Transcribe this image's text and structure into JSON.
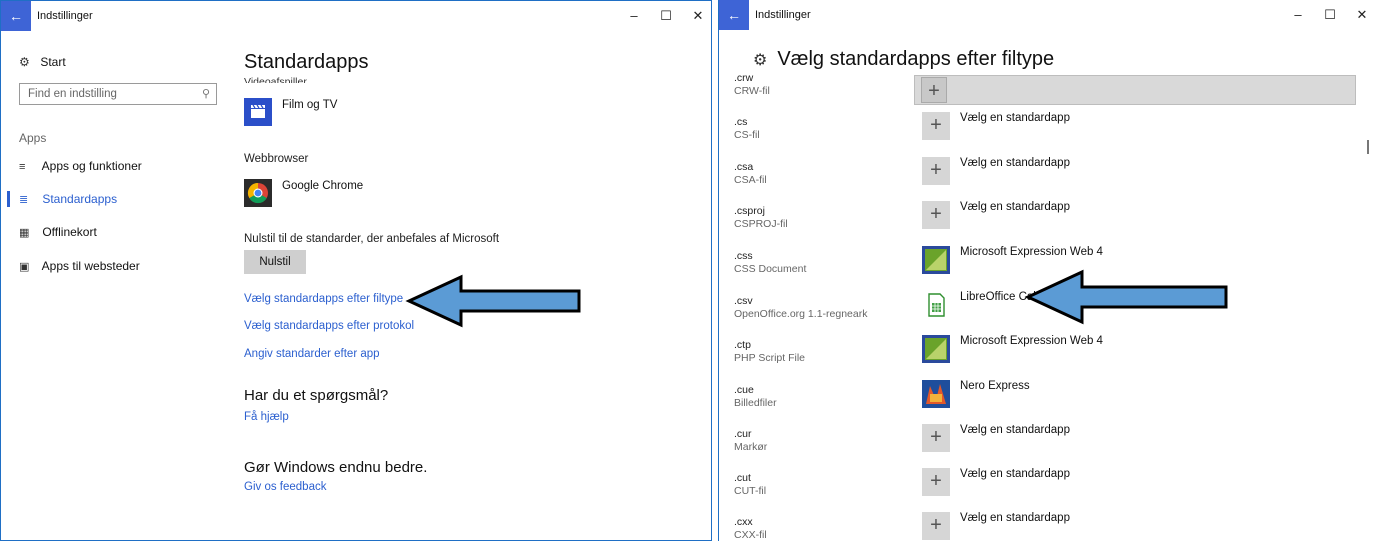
{
  "left": {
    "window_title": "Indstillinger",
    "nav": {
      "start": "Start",
      "search_placeholder": "Find en indstilling",
      "group": "Apps",
      "items": [
        {
          "label": "Apps og funktioner",
          "icon": "list-icon"
        },
        {
          "label": "Standardapps",
          "icon": "defaults-icon"
        },
        {
          "label": "Offlinekort",
          "icon": "map-icon"
        },
        {
          "label": "Apps til websteder",
          "icon": "web-app-icon"
        }
      ]
    },
    "main": {
      "title": "Standardapps",
      "video_label": "Videoafspiller",
      "video_app": "Film og TV",
      "browser_label": "Webbrowser",
      "browser_app": "Google Chrome",
      "reset_label": "Nulstil til de standarder, der anbefales af Microsoft",
      "reset_button": "Nulstil",
      "links": [
        "Vælg standardapps efter filtype",
        "Vælg standardapps efter protokol",
        "Angiv standarder efter app"
      ],
      "question_heading": "Har du et spørgsmål?",
      "help_link": "Få hjælp",
      "feedback_heading": "Gør Windows endnu bedre.",
      "feedback_link": "Giv os feedback"
    }
  },
  "right": {
    "window_title": "Indstillinger",
    "title": "Vælg standardapps efter filtype",
    "rows": [
      {
        "ext": ".crw",
        "desc": "CRW-fil",
        "app": ""
      },
      {
        "ext": ".cs",
        "desc": "CS-fil",
        "app": "Vælg en standardapp"
      },
      {
        "ext": ".csa",
        "desc": "CSA-fil",
        "app": "Vælg en standardapp"
      },
      {
        "ext": ".csproj",
        "desc": "CSPROJ-fil",
        "app": "Vælg en standardapp"
      },
      {
        "ext": ".css",
        "desc": "CSS Document",
        "app": "Microsoft Expression Web 4"
      },
      {
        "ext": ".csv",
        "desc": "OpenOffice.org 1.1-regneark",
        "app": "LibreOffice Calc"
      },
      {
        "ext": ".ctp",
        "desc": "PHP Script File",
        "app": "Microsoft Expression Web 4"
      },
      {
        "ext": ".cue",
        "desc": "Billedfiler",
        "app": "Nero Express"
      },
      {
        "ext": ".cur",
        "desc": "Markør",
        "app": "Vælg en standardapp"
      },
      {
        "ext": ".cut",
        "desc": "CUT-fil",
        "app": "Vælg en standardapp"
      },
      {
        "ext": ".cxx",
        "desc": "CXX-fil",
        "app": "Vælg en standardapp"
      }
    ]
  },
  "colors": {
    "accent": "#2b5fcf",
    "arrow": "#5b9bd5",
    "plus_bg": "#d6d6d6"
  }
}
